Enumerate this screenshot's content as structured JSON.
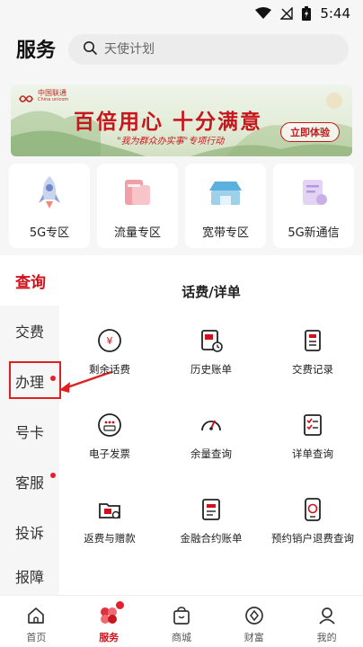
{
  "status_bar": {
    "time": "5:44"
  },
  "header": {
    "title": "服务",
    "search_placeholder": "天使计划"
  },
  "banner": {
    "brand_name": "中国联通",
    "brand_sub": "China unicom",
    "headline": "百倍用心 十分满意",
    "subline": "\"我为群众办实事\"专项行动",
    "cta": "立即体验"
  },
  "zones": [
    {
      "label": "5G专区",
      "icon": "rocket-icon"
    },
    {
      "label": "流量专区",
      "icon": "data-traffic-icon"
    },
    {
      "label": "宽带专区",
      "icon": "broadband-store-icon"
    },
    {
      "label": "5G新通信",
      "icon": "message-document-icon"
    }
  ],
  "side_nav": [
    {
      "label": "查询",
      "active": true,
      "dot": false
    },
    {
      "label": "交费",
      "active": false,
      "dot": false
    },
    {
      "label": "办理",
      "active": false,
      "dot": true
    },
    {
      "label": "号卡",
      "active": false,
      "dot": false
    },
    {
      "label": "客服",
      "active": false,
      "dot": true
    },
    {
      "label": "投诉",
      "active": false,
      "dot": false
    },
    {
      "label": "报障",
      "active": false,
      "dot": false
    }
  ],
  "section": {
    "title": "话费/详单",
    "items": [
      {
        "label": "剩余话费",
        "icon": "yuan-coin-icon"
      },
      {
        "label": "历史账单",
        "icon": "bill-history-icon"
      },
      {
        "label": "交费记录",
        "icon": "payment-record-icon"
      },
      {
        "label": "电子发票",
        "icon": "e-invoice-icon"
      },
      {
        "label": "余量查询",
        "icon": "gauge-icon"
      },
      {
        "label": "详单查询",
        "icon": "detail-list-icon"
      },
      {
        "label": "返费与赠款",
        "icon": "rebate-folder-icon"
      },
      {
        "label": "金融合约账单",
        "icon": "contract-bill-icon"
      },
      {
        "label": "预约销户退费查询",
        "icon": "cancel-refund-icon"
      }
    ]
  },
  "bottom_nav": [
    {
      "label": "首页",
      "icon": "home-icon",
      "active": false,
      "badge": false
    },
    {
      "label": "服务",
      "icon": "service-flower-icon",
      "active": true,
      "badge": true
    },
    {
      "label": "商城",
      "icon": "shopping-bag-icon",
      "active": false,
      "badge": false
    },
    {
      "label": "财富",
      "icon": "wealth-diamond-icon",
      "active": false,
      "badge": false
    },
    {
      "label": "我的",
      "icon": "profile-icon",
      "active": false,
      "badge": false
    }
  ],
  "colors": {
    "accent": "#d0101a",
    "badge": "#e5202e",
    "highlight": "#e02020"
  }
}
